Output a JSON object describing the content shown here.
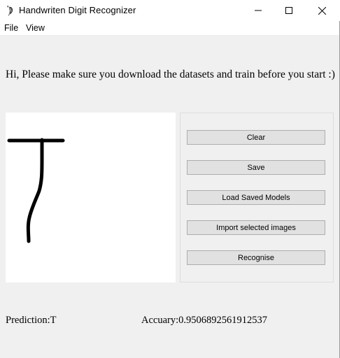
{
  "window": {
    "title": "Handwriten Digit Recognizer",
    "icon": "feather-quill-icon",
    "controls": {
      "minimize": "minimize-icon",
      "maximize": "maximize-icon",
      "close": "close-icon"
    }
  },
  "menu": {
    "items": [
      {
        "label": "File"
      },
      {
        "label": "View"
      }
    ]
  },
  "main": {
    "welcome": "Hi, Please make sure you download the datasets and train before you start :)"
  },
  "canvas": {
    "background": "#ffffff",
    "stroke_color": "#000000"
  },
  "buttons": {
    "clear": "Clear",
    "save": "Save",
    "load": "Load Saved Models",
    "import": "Import selected images",
    "recognise": "Recognise"
  },
  "status": {
    "prediction": "Prediction:T",
    "accuracy": "Accuary:0.9506892561912537"
  },
  "colors": {
    "window_bg": "#f0f0f0",
    "button_bg": "#e1e1e1",
    "button_border": "#adadad"
  }
}
